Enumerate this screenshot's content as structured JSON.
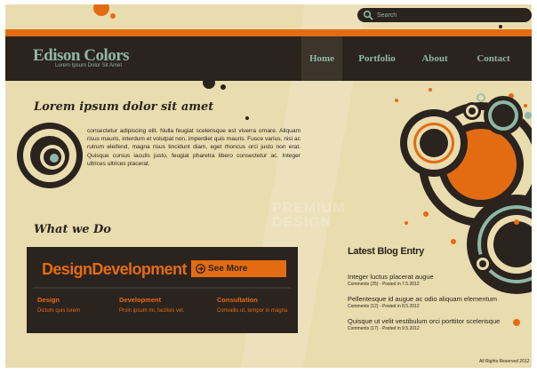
{
  "search": {
    "placeholder": "Search"
  },
  "header": {
    "logo_title": "Edison Colors",
    "logo_subtitle": "Lorem Ipsum Dolor Sit Amet"
  },
  "nav": [
    {
      "label": "Home"
    },
    {
      "label": "Portfolio"
    },
    {
      "label": "About"
    },
    {
      "label": "Contact"
    }
  ],
  "intro": {
    "title": "Lorem ipsum dolor sit amet",
    "text": "consectetur adipiscing elit. Nulla feugiat scelerisque est viverra ornare. Aliquam risus mauris, interdum et volutpat non, imperdiet quis mauris. Fusce varius, nisi ac rutrum eleifend, magna risus tincidunt diam, eget rhoncus orci justo non erat. Quisque cursus iaculis justo, feugiat pharetra libero consectetur ac. Integer ultrices ultrices placerat."
  },
  "what_we_do": {
    "title": "What we Do",
    "banner_title": "DesignDevelopment",
    "see_more": "See More",
    "columns": [
      {
        "heading": "Design",
        "text": "Dictum quis lorem"
      },
      {
        "heading": "Development",
        "text": "Proin ipsum mi, facilisis vel."
      },
      {
        "heading": "Consultation",
        "text": "Convallis ut, tempor in magna"
      }
    ]
  },
  "blog": {
    "title": "Latest Blog Entry",
    "entries": [
      {
        "title": "Integer luctus placerat augue",
        "meta": "Comments (25) - Posted in 7.5.2012"
      },
      {
        "title": "Pellentesque id augue ac odio aliquam elementum",
        "meta": "Comments (12) - Posted in 8.5.2012"
      },
      {
        "title": "Quisque ut velit vestibulum orci porttitor scelerisque",
        "meta": "Comments (17) - Posted in 9.5.2012"
      }
    ]
  },
  "watermark": {
    "line1": "PREMIUM",
    "line2": "DESIGN"
  },
  "footer": {
    "text": "All Rights Reserved 2012"
  },
  "colors": {
    "background": "#e9dcae",
    "dark": "#2b231e",
    "orange": "#e36c12",
    "teal": "#8fb7a5"
  }
}
